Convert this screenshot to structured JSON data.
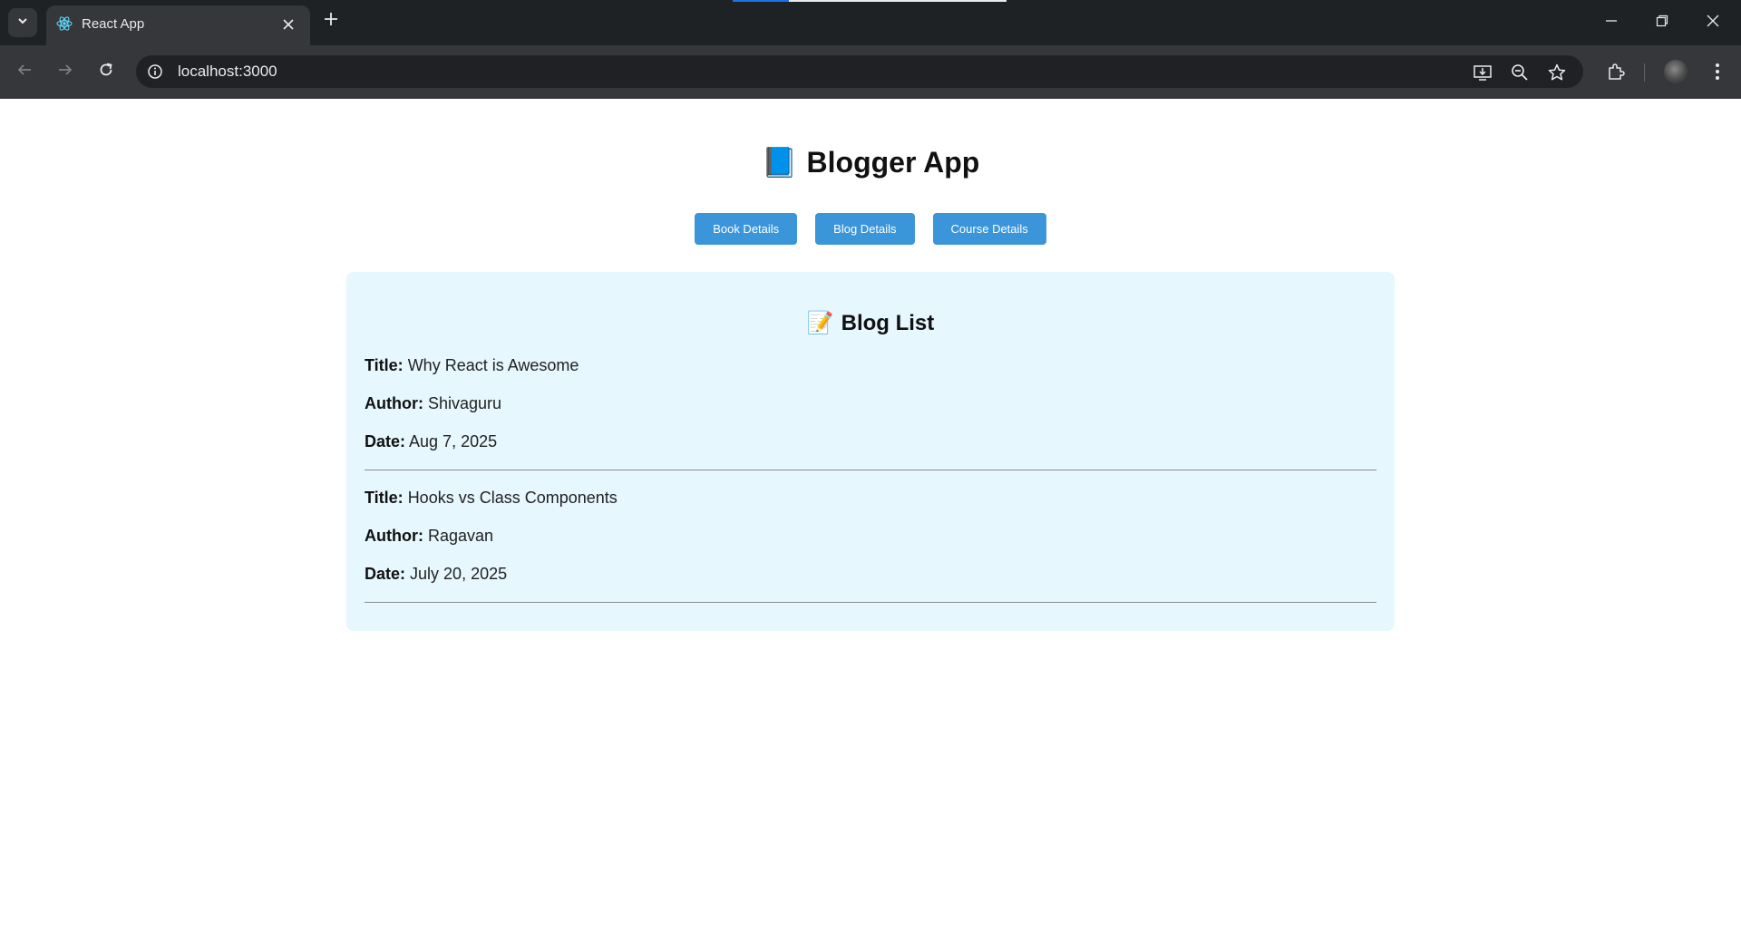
{
  "browser": {
    "tab_title": "React App",
    "url": "localhost:3000"
  },
  "icons": {
    "tab_search": "chevron-down-icon",
    "favicon": "react-icon",
    "tab_close": "close-icon",
    "new_tab": "plus-icon",
    "back": "arrow-left-icon",
    "forward": "arrow-right-icon",
    "reload": "reload-icon",
    "site_info": "info-icon",
    "install": "install-app-icon",
    "zoom": "zoom-out-icon",
    "bookmark": "star-icon",
    "extensions": "puzzle-icon",
    "menu": "kebab-menu-icon"
  },
  "app": {
    "title": "Blogger App",
    "title_emoji": "📘",
    "buttons": {
      "book": "Book Details",
      "blog": "Blog Details",
      "course": "Course Details"
    }
  },
  "blog_list": {
    "heading": "Blog List",
    "heading_emoji": "📝",
    "labels": {
      "title": "Title:",
      "author": "Author:",
      "date": "Date:"
    },
    "items": [
      {
        "title": "Why React is Awesome",
        "author": "Shivaguru",
        "date": "Aug 7, 2025"
      },
      {
        "title": "Hooks vs Class Components",
        "author": "Ragavan",
        "date": "July 20, 2025"
      }
    ]
  },
  "colors": {
    "accent_button": "#3a95d9",
    "card_background": "#e6f7fe"
  }
}
